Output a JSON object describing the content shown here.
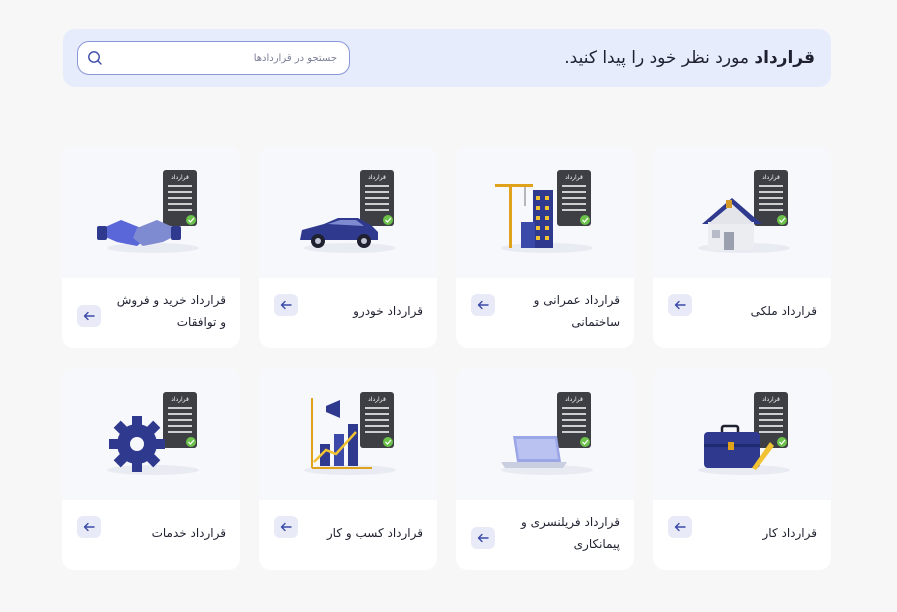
{
  "banner": {
    "title_bold": "قرارداد",
    "title_rest": " مورد نظر خود را پیدا کنید."
  },
  "search": {
    "placeholder": "جستجو در قراردادها"
  },
  "doc_tag": "قرارداد",
  "cards": [
    {
      "label": "قرارداد ملکی",
      "icon": "house-contract-icon"
    },
    {
      "label": "قرارداد عمرانی و ساختمانی",
      "icon": "construction-contract-icon"
    },
    {
      "label": "قرارداد خودرو",
      "icon": "car-contract-icon"
    },
    {
      "label": "قرارداد خرید و فروش و توافقات",
      "icon": "handshake-contract-icon"
    },
    {
      "label": "قرارداد کار",
      "icon": "briefcase-contract-icon"
    },
    {
      "label": "قرارداد فریلنسری و پیمانکاری",
      "icon": "laptop-contract-icon"
    },
    {
      "label": "قرارداد کسب و کار",
      "icon": "business-chart-contract-icon"
    },
    {
      "label": "قرارداد خدمات",
      "icon": "gear-contract-icon"
    }
  ],
  "colors": {
    "banner_bg": "#e6ecfc",
    "card_bg": "#ffffff",
    "arrow_bg": "#e8ebf7",
    "accent_navy": "#3b4aa8",
    "document_dark": "#3d3f45",
    "check_green": "#6cc24a"
  }
}
